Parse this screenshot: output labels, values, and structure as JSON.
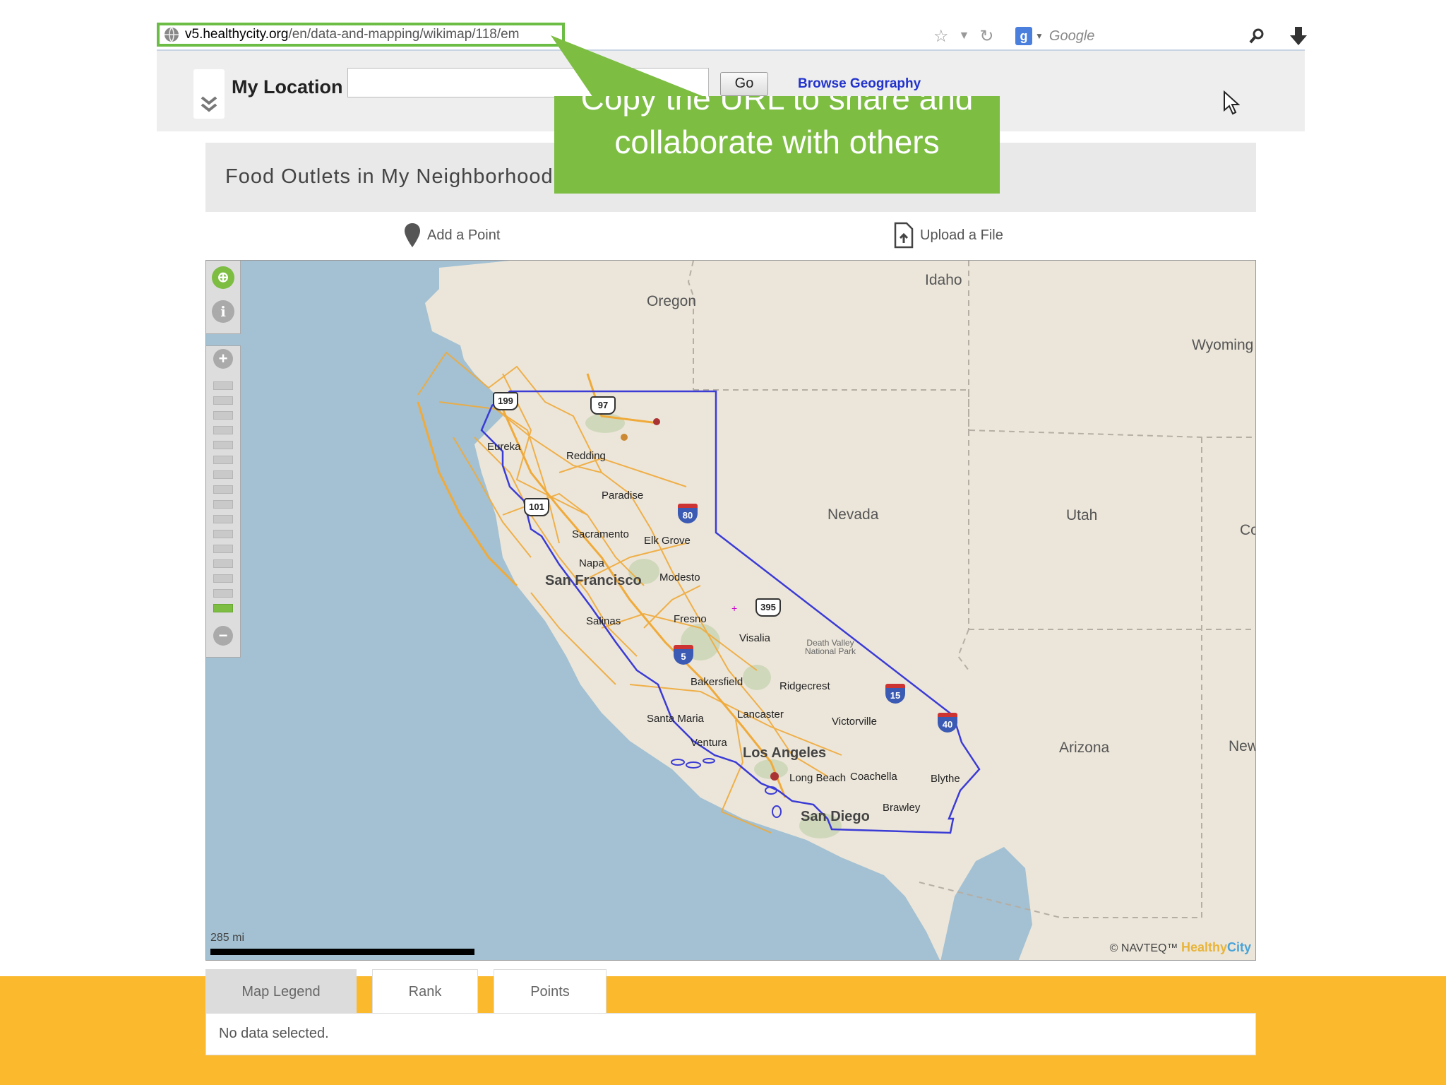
{
  "browser": {
    "url_host": "v5.healthycity.org",
    "url_path": "/en/data-and-mapping/wikimap/118/em",
    "search_engine_text": "Google"
  },
  "toolbar": {
    "location_label": "My Location",
    "go_label": "Go",
    "browse_label": "Browse Geography"
  },
  "callout": {
    "text": "Copy the URL to share and collaborate with others"
  },
  "panel": {
    "title": "Food Outlets in My Neighborhood",
    "add_point_label": "Add a Point",
    "upload_label": "Upload a File"
  },
  "map": {
    "states": {
      "oregon": "Oregon",
      "idaho": "Idaho",
      "wyoming": "Wyoming",
      "nevada": "Nevada",
      "utah": "Utah",
      "colorado": "Co",
      "arizona": "Arizona",
      "new_mexico": "New"
    },
    "cities": {
      "eureka": "Eureka",
      "redding": "Redding",
      "paradise": "Paradise",
      "sacramento": "Sacramento",
      "elk_grove": "Elk Grove",
      "napa": "Napa",
      "san_francisco": "San Francisco",
      "modesto": "Modesto",
      "salinas": "Salinas",
      "fresno": "Fresno",
      "visalia": "Visalia",
      "death_valley": "Death Valley National Park",
      "bakersfield": "Bakersfield",
      "ridgecrest": "Ridgecrest",
      "santa_maria": "Santa Maria",
      "lancaster": "Lancaster",
      "victorville": "Victorville",
      "ventura": "Ventura",
      "los_angeles": "Los Angeles",
      "long_beach": "Long Beach",
      "coachella": "Coachella",
      "blythe": "Blythe",
      "brawley": "Brawley",
      "san_diego": "San Diego"
    },
    "routes": {
      "us199": "199",
      "us97": "97",
      "us101": "101",
      "i80": "80",
      "us395": "395",
      "i5": "5",
      "i15": "15",
      "i40": "40"
    },
    "scale_label": "285 mi",
    "copyright": "© NAVTEQ™",
    "brand_a": "Healthy",
    "brand_b": "City"
  },
  "tabs": [
    {
      "label": "Map Legend"
    },
    {
      "label": "Rank"
    },
    {
      "label": "Points"
    }
  ],
  "tab_content": "No data selected.",
  "colors": {
    "accent_green": "#7cbd42",
    "bottom_bar": "#fbb92e",
    "ocean": "#a3c1d3",
    "land": "#ece6da",
    "boundary": "#3b3bd6"
  }
}
